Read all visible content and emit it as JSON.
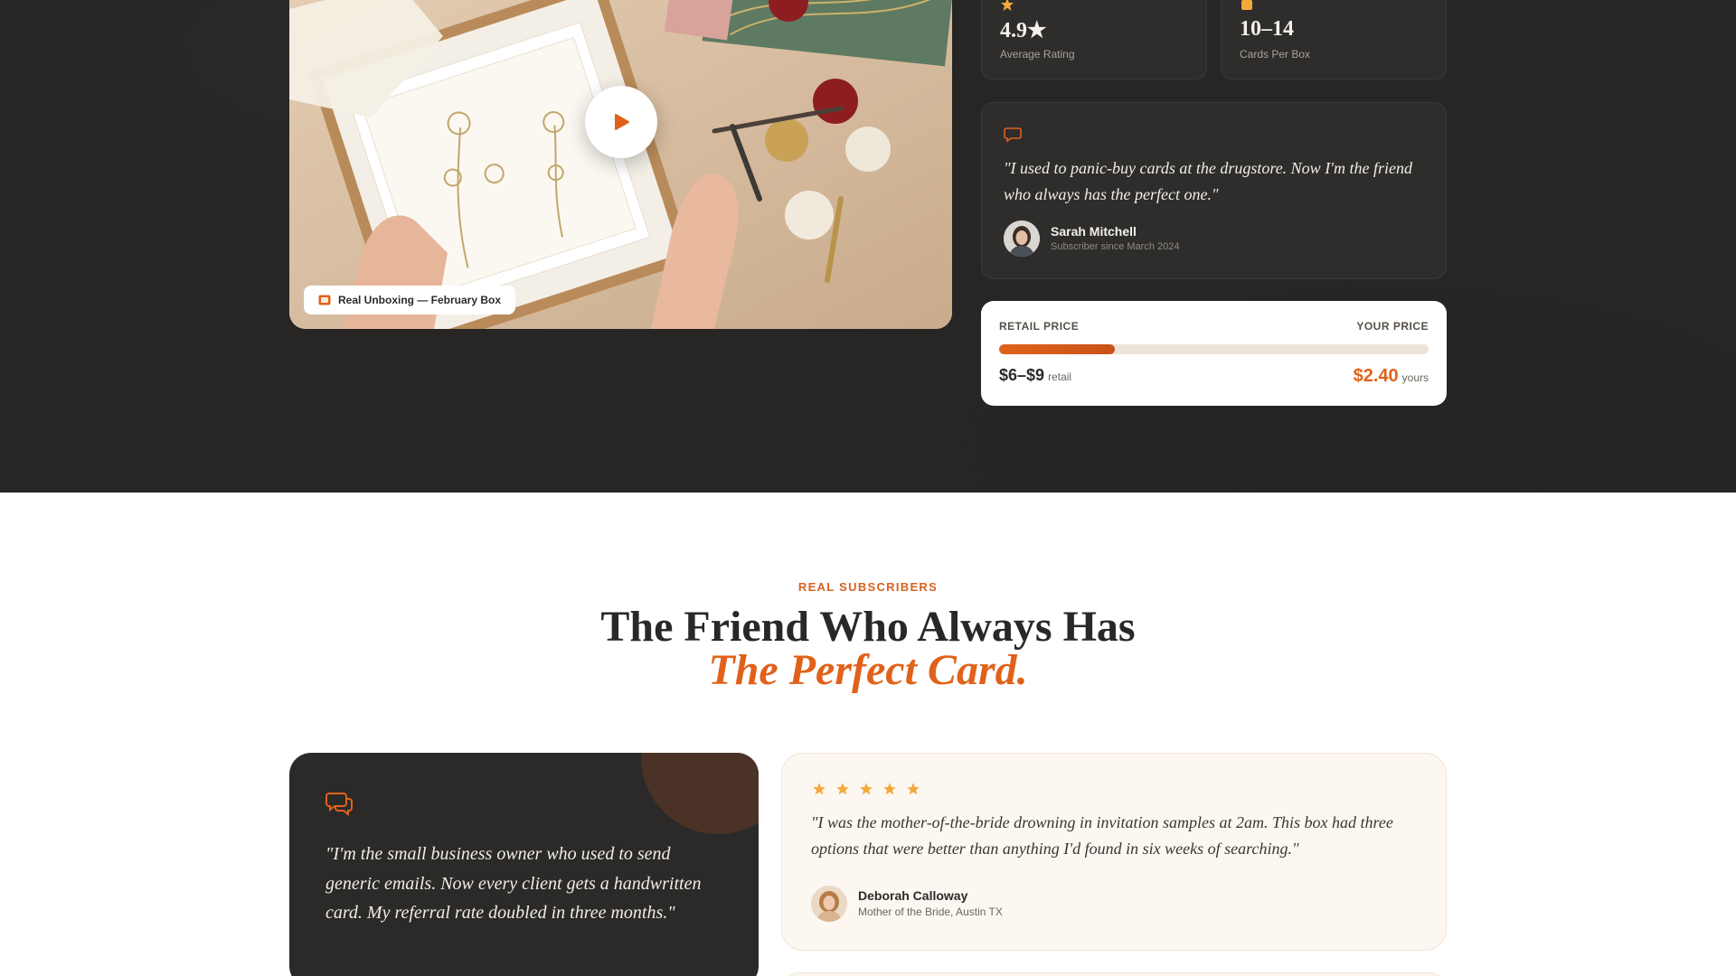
{
  "hero": {
    "video_badge": "Real Unboxing — February Box",
    "stats": [
      {
        "value": "4.9★",
        "label": "Average Rating",
        "icon": "star-icon"
      },
      {
        "value": "10–14",
        "label": "Cards Per Box",
        "icon": "box-icon"
      }
    ],
    "quote": {
      "text": "\"I used to panic-buy cards at the drugstore. Now I'm the friend who always has the perfect one.\"",
      "name": "Sarah Mitchell",
      "since": "Subscriber since March 2024"
    },
    "price": {
      "left_label": "RETAIL PRICE",
      "right_label": "YOUR PRICE",
      "retail_value": "$6–$9",
      "retail_suffix": "retail",
      "your_value": "$2.40",
      "your_suffix": "yours",
      "bar_fraction": 0.27
    }
  },
  "testimonials": {
    "eyebrow": "REAL SUBSCRIBERS",
    "heading_line1": "The Friend Who Always Has",
    "heading_line2": "The Perfect Card.",
    "featured_quote": "\"I'm the small business owner who used to send generic emails. Now every client gets a handwritten card. My referral rate doubled in three months.\"",
    "cards": [
      {
        "stars": 5,
        "text": "\"I was the mother-of-the-bride drowning in invitation samples at 2am. This box had three options that were better than anything I'd found in six weeks of searching.\"",
        "name": "Deborah Calloway",
        "role": "Mother of the Bride, Austin TX"
      }
    ]
  },
  "colors": {
    "accent": "#e0621a",
    "dark_bg": "#272625",
    "star": "#f2a93b"
  }
}
